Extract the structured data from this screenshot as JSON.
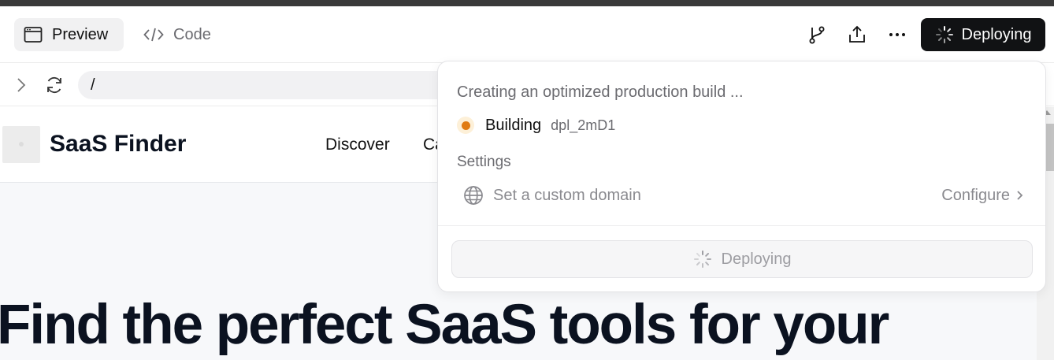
{
  "toolbar": {
    "tabs": [
      {
        "label": "Preview",
        "icon": "browser-window-icon",
        "active": true
      },
      {
        "label": "Code",
        "icon": "code-icon",
        "active": false
      }
    ],
    "icons": [
      "git-branch-icon",
      "share-icon",
      "more-icon"
    ],
    "deploy_label": "Deploying"
  },
  "addressbar": {
    "path": "/"
  },
  "site": {
    "title": "SaaS Finder",
    "nav": [
      "Discover",
      "Ca"
    ],
    "hero": "Find the perfect SaaS tools for your"
  },
  "popover": {
    "status": "Creating an optimized production build ...",
    "build_state": "Building",
    "build_id": "dpl_2mD1",
    "settings_heading": "Settings",
    "domain_text": "Set a custom domain",
    "configure_label": "Configure",
    "deploy_label": "Deploying"
  },
  "colors": {
    "deploy_button": "#111214",
    "building_dot": "#e07b13"
  }
}
